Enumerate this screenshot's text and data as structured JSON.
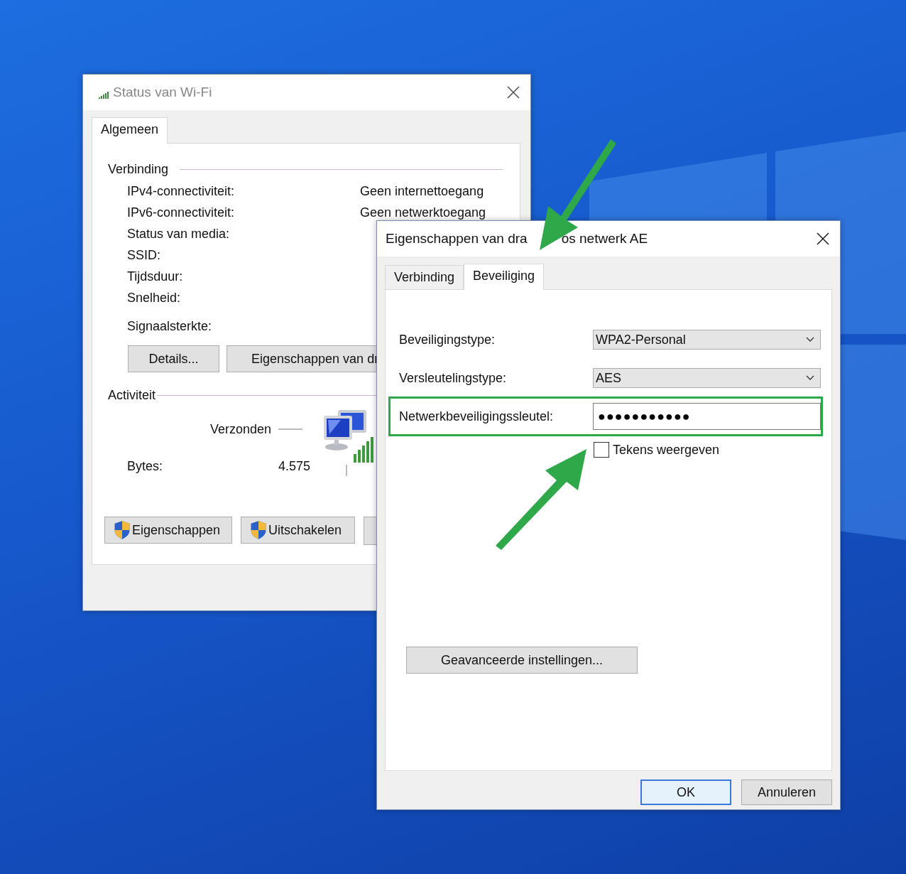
{
  "status_window": {
    "title": "Status van Wi-Fi",
    "tabs": [
      {
        "label": "Algemeen",
        "selected": true
      }
    ],
    "connection": {
      "heading": "Verbinding",
      "rows": [
        {
          "label": "IPv4-connectiviteit:",
          "value": "Geen internettoegang"
        },
        {
          "label": "IPv6-connectiviteit:",
          "value": "Geen netwerktoegang"
        },
        {
          "label": "Status van media:"
        },
        {
          "label": "SSID:"
        },
        {
          "label": "Tijdsduur:"
        },
        {
          "label": "Snelheid:"
        }
      ],
      "signal_label": "Signaalsterkte:",
      "buttons": [
        "Details...",
        "Eigenschappen van dr"
      ]
    },
    "activity": {
      "heading": "Activiteit",
      "sent_label": "Verzonden",
      "bytes_label": "Bytes:",
      "bytes_sent": "4.575"
    },
    "buttons": [
      {
        "label": "Eigenschappen",
        "shield": true
      },
      {
        "label": "Uitschakelen",
        "shield": true
      }
    ]
  },
  "properties_window": {
    "title_parts": [
      "Eigenschappen van dra",
      "os netwerk AE"
    ],
    "tabs": [
      {
        "label": "Verbinding",
        "selected": false
      },
      {
        "label": "Beveiliging",
        "selected": true
      }
    ],
    "fields": [
      {
        "kind": "dropdown",
        "label": "Beveiligingstype:",
        "value": "WPA2-Personal",
        "highlighted": false
      },
      {
        "kind": "dropdown",
        "label": "Versleutelingstype:",
        "value": "AES",
        "highlighted": false
      },
      {
        "kind": "password",
        "label": "Netwerkbeveiligingssleutel:",
        "value": "●●●●●●●●●●●",
        "highlighted": true
      }
    ],
    "checkbox": {
      "label": "Tekens weergeven",
      "checked": false
    },
    "advanced_button": "Geavanceerde instellingen...",
    "buttons": [
      {
        "label": "OK",
        "default": true
      },
      {
        "label": "Annuleren",
        "default": false
      }
    ]
  }
}
